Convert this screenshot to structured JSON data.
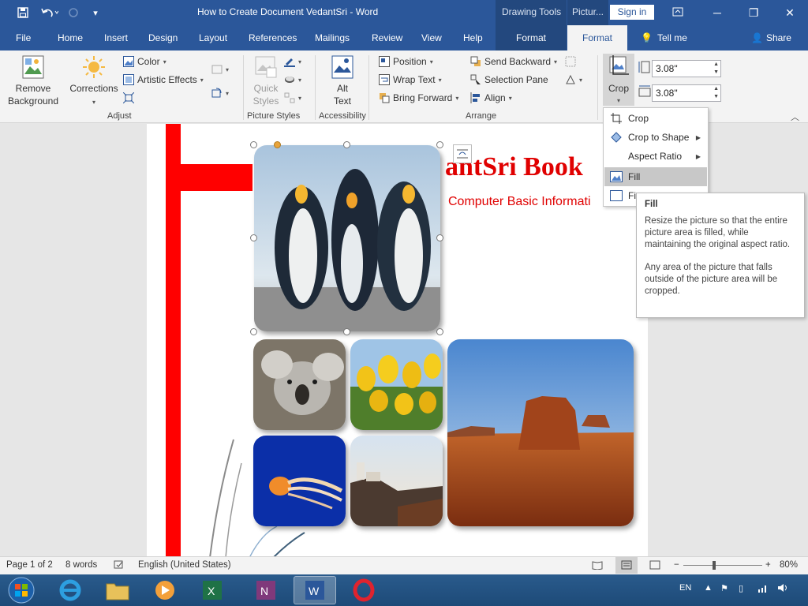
{
  "window": {
    "title": "How to Create Document VedantSri  -  Word",
    "drawing_tools": "Drawing Tools",
    "picture_tools": "Pictur...",
    "signin": "Sign in"
  },
  "tabs": {
    "file": "File",
    "home": "Home",
    "insert": "Insert",
    "design": "Design",
    "layout": "Layout",
    "references": "References",
    "mailings": "Mailings",
    "review": "Review",
    "view": "View",
    "help": "Help",
    "format_drawing": "Format",
    "format_picture": "Format",
    "tellme": "Tell me",
    "share": "Share"
  },
  "ribbon": {
    "adjust": {
      "label": "Adjust",
      "remove_background_1": "Remove",
      "remove_background_2": "Background",
      "corrections": "Corrections",
      "color": "Color",
      "artistic_effects": "Artistic Effects"
    },
    "picture_styles": {
      "label": "Picture Styles",
      "quick_styles_1": "Quick",
      "quick_styles_2": "Styles"
    },
    "accessibility": {
      "label": "Accessibility",
      "alt_text_1": "Alt",
      "alt_text_2": "Text"
    },
    "arrange": {
      "label": "Arrange",
      "position": "Position",
      "wrap_text": "Wrap Text",
      "bring_forward": "Bring Forward",
      "send_backward": "Send Backward",
      "selection_pane": "Selection Pane",
      "align": "Align"
    },
    "size": {
      "crop": "Crop",
      "height": "3.08\"",
      "width": "3.08\""
    }
  },
  "document": {
    "heading": "antSri Book",
    "subheading": "Computer Basic Informati"
  },
  "crop_menu": {
    "items": [
      "Crop",
      "Crop to Shape",
      "Aspect Ratio",
      "Fill",
      "Fi"
    ]
  },
  "tooltip": {
    "title": "Fill",
    "p1": "Resize the picture so that the entire picture area is filled, while maintaining the original aspect ratio.",
    "p2": "Any area of the picture that falls outside of the picture area will be cropped."
  },
  "status": {
    "page": "Page 1 of 2",
    "words": "8 words",
    "language": "English (United States)",
    "zoom": "80%",
    "zoom_level": 0.8
  },
  "taskbar": {
    "lang": "EN"
  },
  "colors": {
    "word_blue": "#2b579a",
    "accent_red": "#ff0000"
  }
}
